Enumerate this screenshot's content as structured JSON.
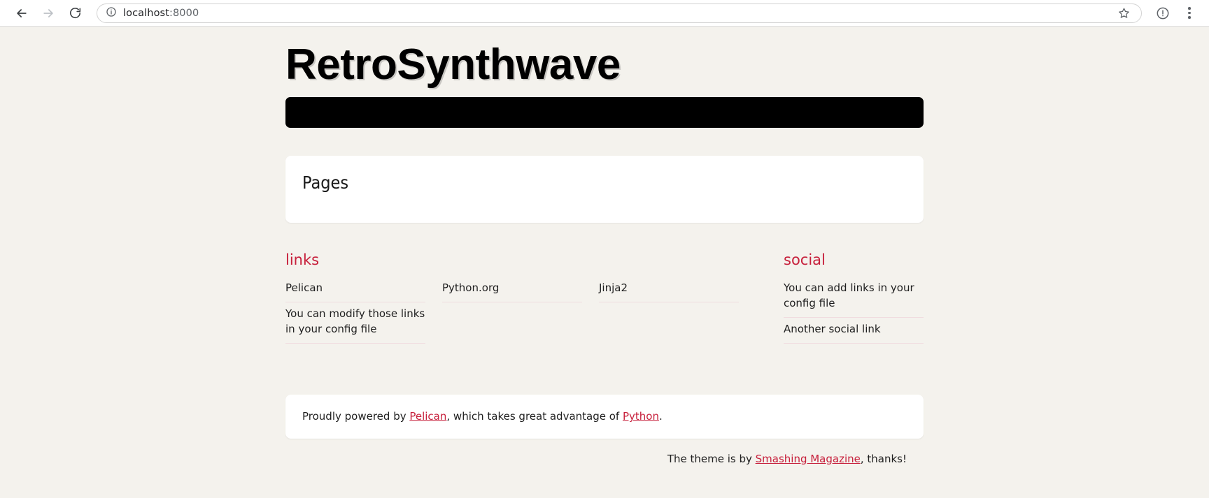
{
  "browser": {
    "back_label": "Back",
    "forward_label": "Forward",
    "reload_label": "Reload",
    "site_info_label": "site-information",
    "url_host": "localhost",
    "url_port": ":8000",
    "bookmark_label": "Bookmark this tab",
    "profile_label": "Profile",
    "menu_label": "Customize and control"
  },
  "site": {
    "title": "RetroSynthwave"
  },
  "pages": {
    "heading": "Pages"
  },
  "links_widget": {
    "title": "links",
    "items": [
      "Pelican",
      "Python.org",
      "Jinja2",
      "You can modify those links in your config file"
    ]
  },
  "social_widget": {
    "title": "social",
    "items": [
      "You can add links in your config file",
      "Another social link"
    ]
  },
  "footer": {
    "prefix": "Proudly powered by ",
    "pelican_link": "Pelican",
    "middle": ", which takes great advantage of ",
    "python_link": "Python",
    "suffix": ".",
    "credit_prefix": "The theme is by ",
    "credit_link": "Smashing Magazine",
    "credit_suffix": ", thanks!"
  },
  "colors": {
    "background": "#f4f2ed",
    "card": "#ffffff",
    "accent": "#c7203c",
    "navbar": "#000000"
  }
}
